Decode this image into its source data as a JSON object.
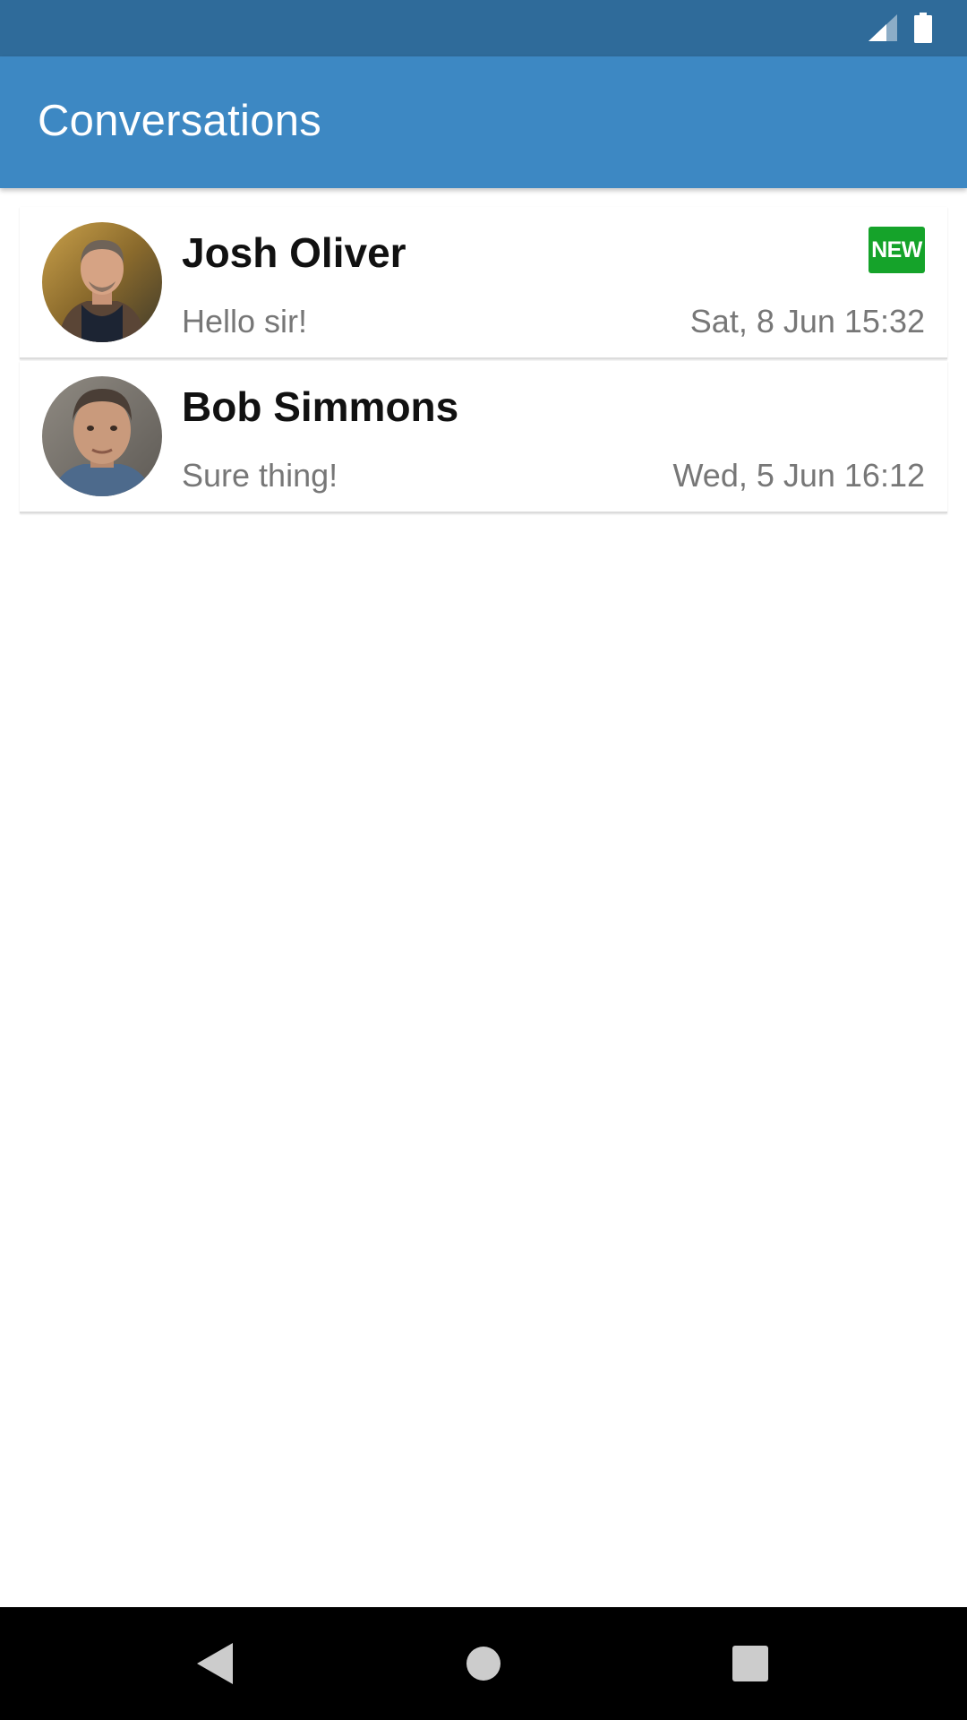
{
  "app": {
    "title": "Conversations",
    "bar_color": "#3d88c3",
    "status_bar_color": "#2f6b9a"
  },
  "status_bar": {
    "icons": [
      "signal-icon",
      "battery-icon"
    ]
  },
  "conversations": [
    {
      "name": "Josh Oliver",
      "preview": "Hello sir!",
      "time": "Sat, 8 Jun 15:32",
      "badge": "NEW",
      "badge_color": "#15a32a",
      "avatar": "avatar-photo"
    },
    {
      "name": "Bob Simmons",
      "preview": "Sure thing!",
      "time": "Wed, 5 Jun 16:12",
      "avatar": "avatar-photo"
    }
  ],
  "nav_bar": {
    "buttons": [
      "back-icon",
      "home-icon",
      "recents-icon"
    ]
  }
}
